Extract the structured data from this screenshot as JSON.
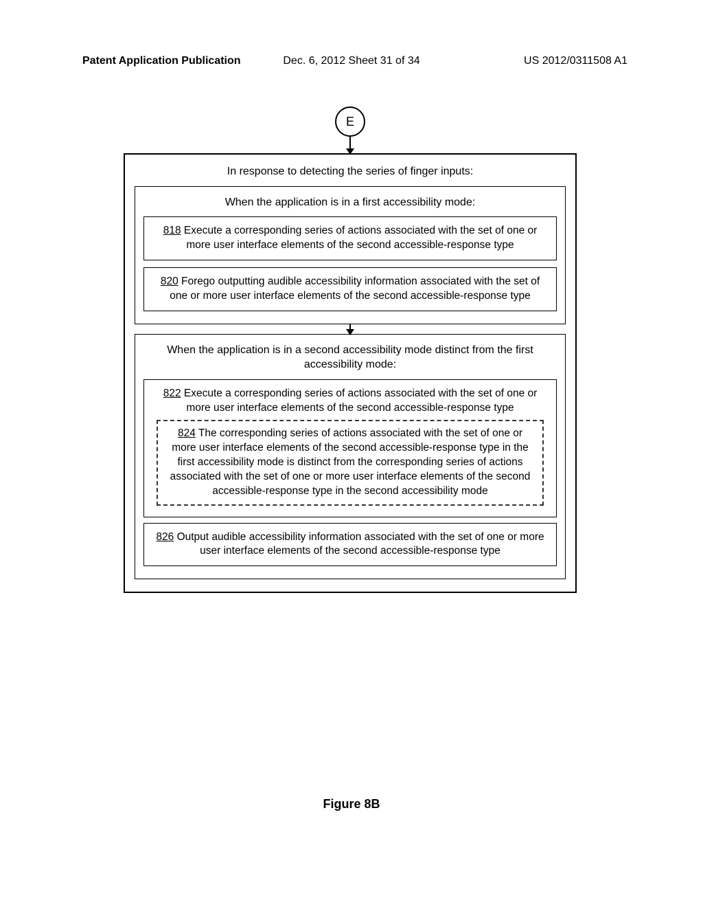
{
  "header": {
    "left": "Patent Application Publication",
    "center": "Dec. 6, 2012  Sheet 31 of 34",
    "right": "US 2012/0311508 A1"
  },
  "diagram": {
    "connector_label": "E",
    "outer_title": "In response to detecting the series of finger inputs:",
    "first_mode": {
      "title": "When the application is in a first accessibility mode:",
      "step818_ref": "818",
      "step818_text": "  Execute a corresponding series of actions associated with the set of one or more user interface elements of the second accessible-response type",
      "step820_ref": "820",
      "step820_text": "  Forego outputting audible accessibility information associated with the set of one or more user interface elements of the second accessible-response type"
    },
    "second_mode": {
      "title": "When the application is in a second accessibility mode distinct from the first accessibility mode:",
      "step822_ref": "822",
      "step822_text": "  Execute a corresponding series of actions associated with the set of one or more user interface elements of the second accessible-response type",
      "step824_ref": "824",
      "step824_text": "  The corresponding series of actions associated with the set of one or more user interface elements of the second accessible-response type in the first accessibility mode is distinct from the corresponding series of actions associated with the set of one or more user interface elements of the second accessible-response type in the second accessibility mode",
      "step826_ref": "826",
      "step826_text": "  Output audible accessibility information associated with the set of one or more user interface elements of the second accessible-response type"
    }
  },
  "figure_caption": "Figure 8B"
}
